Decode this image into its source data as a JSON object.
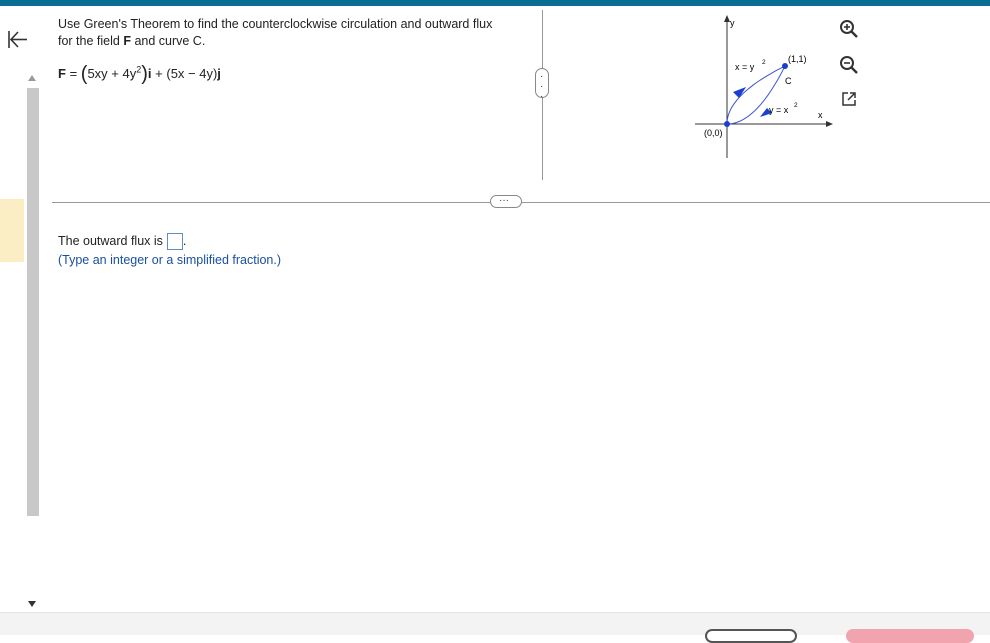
{
  "question": {
    "line1": "Use Green's Theorem to find the counterclockwise circulation and outward flux",
    "line2_pre": "for the field ",
    "line2_bold": "F",
    "line2_post": " and curve C."
  },
  "formula": {
    "lhs": "F",
    "eq": " = ",
    "term1": "5xy + 4y",
    "exp1": "2",
    "i": "i",
    "plus": " + (5x − 4y)",
    "j": "j"
  },
  "answer": {
    "label": "The outward flux is",
    "suffix": ".",
    "input_value": "",
    "hint": "(Type an integer or a simplified fraction.)"
  },
  "graph": {
    "y_axis": "y",
    "x_axis": "x",
    "origin_label": "(0,0)",
    "point_label": "(1,1)",
    "curve_label": "C",
    "upper_curve_label": "x = y",
    "upper_curve_exp": "2",
    "lower_curve_label": "y = x",
    "lower_curve_exp": "2",
    "curve_color": "#3a55d6",
    "point_color": "#1a3fd0"
  },
  "icons": {
    "back": "back-to-start-icon",
    "zoom_in": "zoom-in-icon",
    "zoom_out": "zoom-out-icon",
    "popout": "popout-icon"
  },
  "handles": {
    "dots": "···"
  },
  "colors": {
    "topbar": "#0a6d94",
    "hint": "#1a4fa0",
    "input_border": "#5a8fc8",
    "marker": "#fbeec4"
  }
}
